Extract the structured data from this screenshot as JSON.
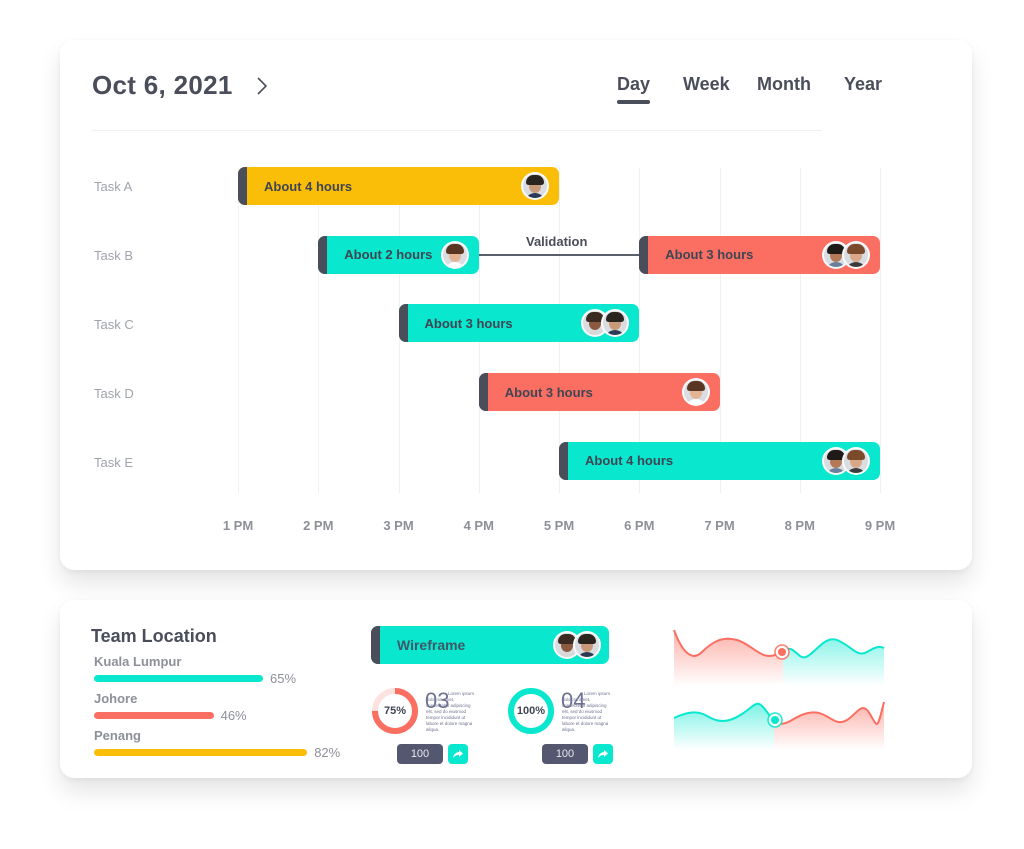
{
  "header": {
    "date": "Oct 6, 2021",
    "next_icon": "chevron-right-icon",
    "tabs": [
      {
        "label": "Day",
        "active": true
      },
      {
        "label": "Week",
        "active": false
      },
      {
        "label": "Month",
        "active": false
      },
      {
        "label": "Year",
        "active": false
      }
    ]
  },
  "colors": {
    "yellow": "#fbbe08",
    "teal": "#09e8cf",
    "coral": "#fb6f62",
    "dark": "#4a4d5a",
    "muted": "#8d9099"
  },
  "chart_data": {
    "type": "gantt",
    "title": "Oct 6, 2021",
    "xlabel": "",
    "ylabel": "",
    "x_ticks": [
      "1 PM",
      "2 PM",
      "3 PM",
      "4 PM",
      "5 PM",
      "6 PM",
      "7 PM",
      "8 PM",
      "9 PM"
    ],
    "x_range_hours": [
      13,
      21
    ],
    "grid": true,
    "rows": [
      "Task A",
      "Task B",
      "Task C",
      "Task D",
      "Task E"
    ],
    "bars": [
      {
        "row": 0,
        "start": 13,
        "end": 17,
        "label": "About 4 hours",
        "color": "yellow",
        "avatars": 1
      },
      {
        "row": 1,
        "start": 14,
        "end": 16,
        "label": "About 2 hours",
        "color": "teal",
        "avatars": 1
      },
      {
        "row": 1,
        "start": 18,
        "end": 21,
        "label": "About 3 hours",
        "color": "coral",
        "avatars": 2
      },
      {
        "row": 2,
        "start": 15,
        "end": 18,
        "label": "About 3 hours",
        "color": "teal",
        "avatars": 2
      },
      {
        "row": 3,
        "start": 16,
        "end": 19,
        "label": "About 3 hours",
        "color": "coral",
        "avatars": 1
      },
      {
        "row": 4,
        "start": 17,
        "end": 21,
        "label": "About 4 hours",
        "color": "teal",
        "avatars": 2
      }
    ],
    "dependencies": [
      {
        "from_bar": 1,
        "to_bar": 2,
        "label": "Validation"
      }
    ]
  },
  "team_location": {
    "title": "Team Location",
    "items": [
      {
        "name": "Kuala Lumpur",
        "percent": 65,
        "percent_label": "65%",
        "color": "teal"
      },
      {
        "name": "Johore",
        "percent": 46,
        "percent_label": "46%",
        "color": "coral"
      },
      {
        "name": "Penang",
        "percent": 82,
        "percent_label": "82%",
        "color": "yellow"
      }
    ]
  },
  "wireframe": {
    "label": "Wireframe",
    "avatars": 2
  },
  "steps": [
    {
      "progress": 75,
      "progress_label": "75%",
      "number": "03",
      "ring_color": "coral",
      "text": "Lorem ipsum dolor sit amet, consectetur adipiscing elit, sed do eiusmod tempor incididunt ut labore et dolore magna aliqua.",
      "count": "100",
      "share_icon": "share-icon"
    },
    {
      "progress": 100,
      "progress_label": "100%",
      "number": "04",
      "ring_color": "teal",
      "text": "Lorem ipsum dolor sit amet, consectetur adipiscing elit, sed do eiusmod tempor incididunt ut labore et dolore magna aliqua.",
      "count": "100",
      "share_icon": "share-icon"
    }
  ],
  "wave_charts": [
    {
      "left_color": "coral",
      "right_color": "teal",
      "marker_color": "coral"
    },
    {
      "left_color": "teal",
      "right_color": "coral",
      "marker_color": "teal"
    }
  ]
}
